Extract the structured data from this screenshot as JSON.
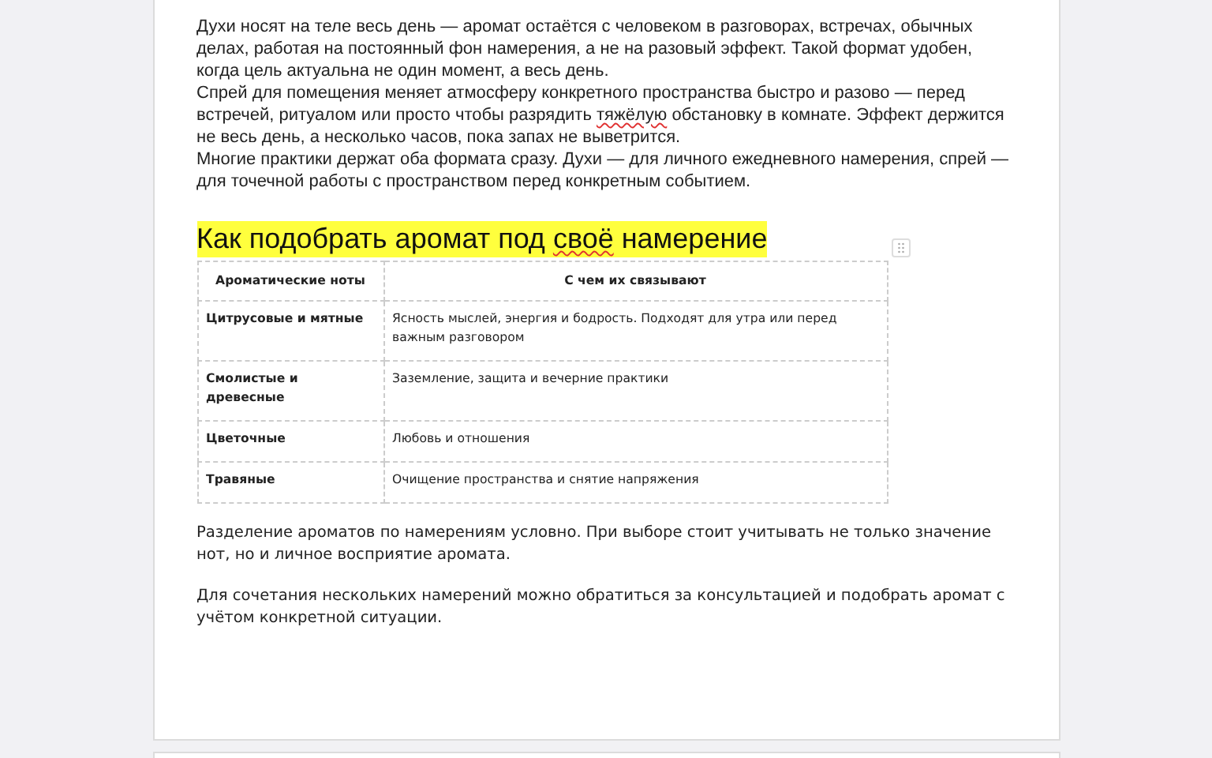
{
  "paragraphs": [
    [
      {
        "text": "Духи носят на теле весь день — аромат остаётся с человеком в разговорах, встречах, обычных делах, работая на постоянный фон намерения, а не на разовый эффект. Такой формат удобен, когда цель актуальна не один момент, а весь день.",
        "misspelled": false
      }
    ],
    [
      {
        "text": "Спрей для помещения меняет атмосферу конкретного пространства быстро и разово — перед встречей, ритуалом или просто чтобы разрядить ",
        "misspelled": false
      },
      {
        "text": "тяжёлую",
        "misspelled": true
      },
      {
        "text": " обстановку в комнате. Эффект держится не весь день, а несколько часов, пока запах не выветрится.",
        "misspelled": false
      }
    ],
    [
      {
        "text": "Многие практики держат оба формата сразу. Духи — для личного ежедневного намерения, спрей — для точечной работы с пространством перед конкретным событием.",
        "misspelled": false
      }
    ]
  ],
  "heading": [
    {
      "text": "Как подобрать аромат под ",
      "misspelled": false
    },
    {
      "text": "своё",
      "misspelled": true
    },
    {
      "text": " намерение",
      "misspelled": false
    }
  ],
  "table": {
    "columns": [
      "Ароматические ноты",
      "С чем их связывают"
    ],
    "rows": [
      [
        "Цитрусовые и мятные",
        "Ясность мыслей, энергия и бодрость. Подходят для утра или перед важным разговором"
      ],
      [
        "Смолистые и древесные",
        "Заземление, защита и вечерние практики"
      ],
      [
        "Цветочные",
        "Любовь и отношения"
      ],
      [
        "Травяные",
        "Очищение пространства и снятие напряжения"
      ]
    ]
  },
  "notes": [
    "Разделение ароматов по намерениям условно. При выборе стоит учитывать не только значение нот, но и личное восприятие аромата.",
    "Для сочетания нескольких намерений можно обратиться за консультацией и подобрать аромат с учётом конкретной ситуации."
  ]
}
